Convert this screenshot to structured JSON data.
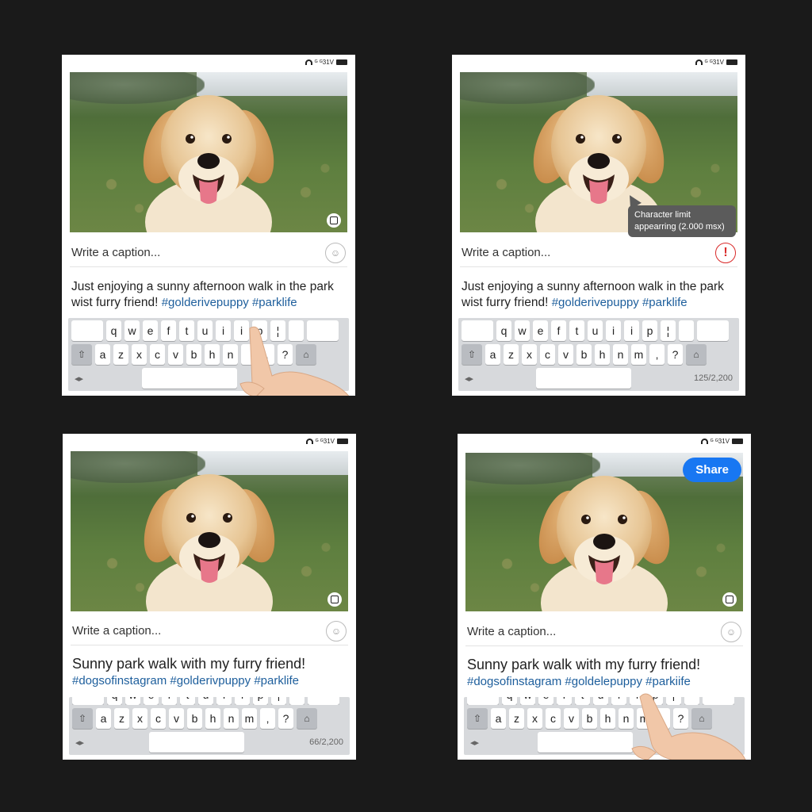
{
  "status": {
    "p1": "ᴳ ᴳ31V",
    "p2": "ᴳ ᴳ31V",
    "p3": "ᴳ ᴳ31V",
    "p4": "ᴳ ᴳ31V"
  },
  "caption_placeholder": "Write a caption...",
  "draft_caption": {
    "text": "Just enjoying a sunny afternoon walk in the park wist furry friend! ",
    "tags": "#golderivepuppy #parklife"
  },
  "final_caption_p3": {
    "text": "Sunny park walk with my furry friend!",
    "tags": "#dogsofinstagram #golderivpuppy #parklife"
  },
  "final_caption_p4": {
    "text": "Sunny park walk with my furry friend!",
    "tags": "#dogsofinstagram #goldelepuppy #parkiife"
  },
  "tooltip": {
    "line1": "Character limit",
    "line2": "appearring (2.000 msx)"
  },
  "error_icon": "!",
  "counters": {
    "p2": "125/2,200",
    "p3": "66/2,200"
  },
  "share_label": "Share",
  "keyboard": {
    "row1": [
      "",
      "q",
      "w",
      "e",
      "f",
      "t",
      "u",
      "i",
      "i",
      "p",
      "¦",
      "",
      ""
    ],
    "row2": [
      "⇧",
      "a",
      "z",
      "x",
      "c",
      "v",
      "b",
      "h",
      "n",
      "m",
      "‚",
      "?",
      "⌂"
    ],
    "row2_p1": [
      "⇧",
      "a",
      "z",
      "x",
      "c",
      "v",
      "b",
      "h",
      "n",
      "",
      "‚",
      "?",
      "⌂"
    ],
    "left_nav": "◂▸"
  },
  "icons": {
    "photo_corner": "crop-icon",
    "emoji": "emoji-icon",
    "error": "error-icon"
  },
  "colors": {
    "share": "#1877f2",
    "hashtag": "#1d5e9c",
    "error": "#d92a2a"
  }
}
